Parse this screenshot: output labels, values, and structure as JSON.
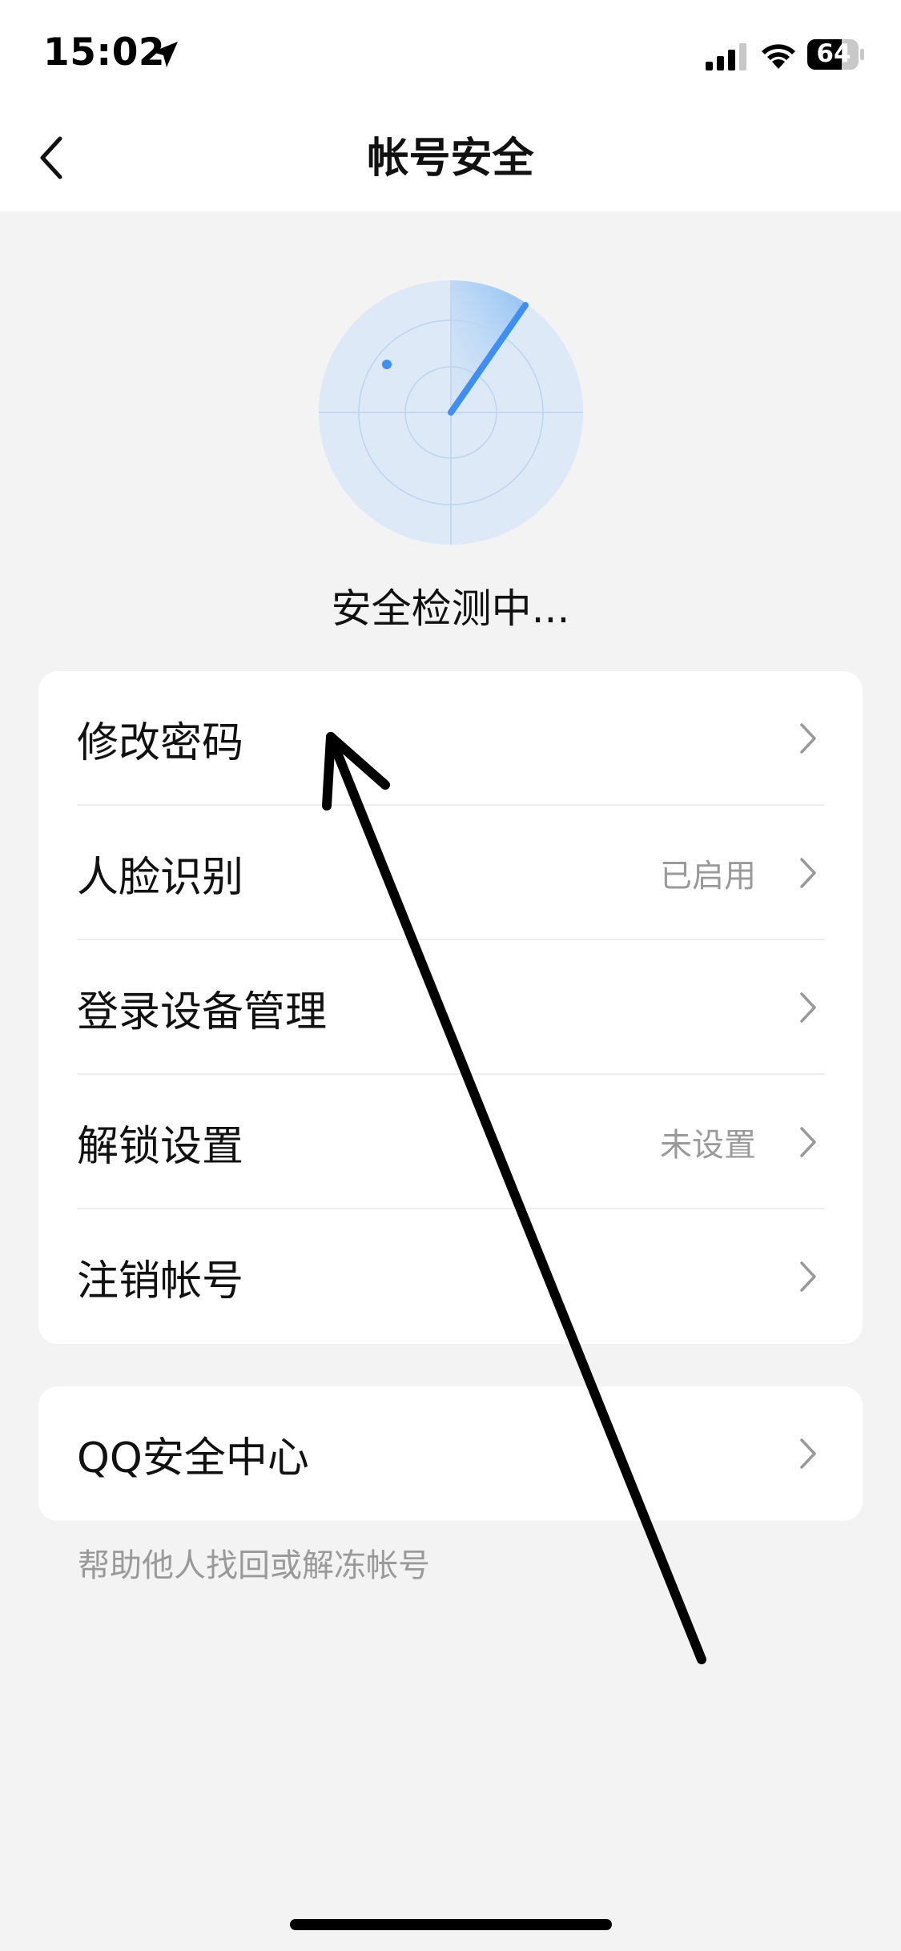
{
  "status_bar": {
    "time": "15:02",
    "battery": "64",
    "icons": [
      "location-arrow-icon",
      "cellular-signal-icon",
      "wifi-icon",
      "battery-icon"
    ]
  },
  "nav": {
    "title": "帐号安全",
    "back_icon": "chevron-left-icon"
  },
  "scan": {
    "status": "安全检测中..."
  },
  "menu": {
    "items": [
      {
        "label": "修改密码",
        "value": ""
      },
      {
        "label": "人脸识别",
        "value": "已启用"
      },
      {
        "label": "登录设备管理",
        "value": ""
      },
      {
        "label": "解锁设置",
        "value": "未设置"
      },
      {
        "label": "注销帐号",
        "value": ""
      }
    ]
  },
  "qq_center": {
    "label": "QQ安全中心",
    "help": "帮助他人找回或解冻帐号"
  },
  "colors": {
    "accent_blue": "#3d8ef5",
    "radar_fill": "#dde9f6",
    "background": "#f3f3f3",
    "secondary_text": "#9a9a9a"
  }
}
